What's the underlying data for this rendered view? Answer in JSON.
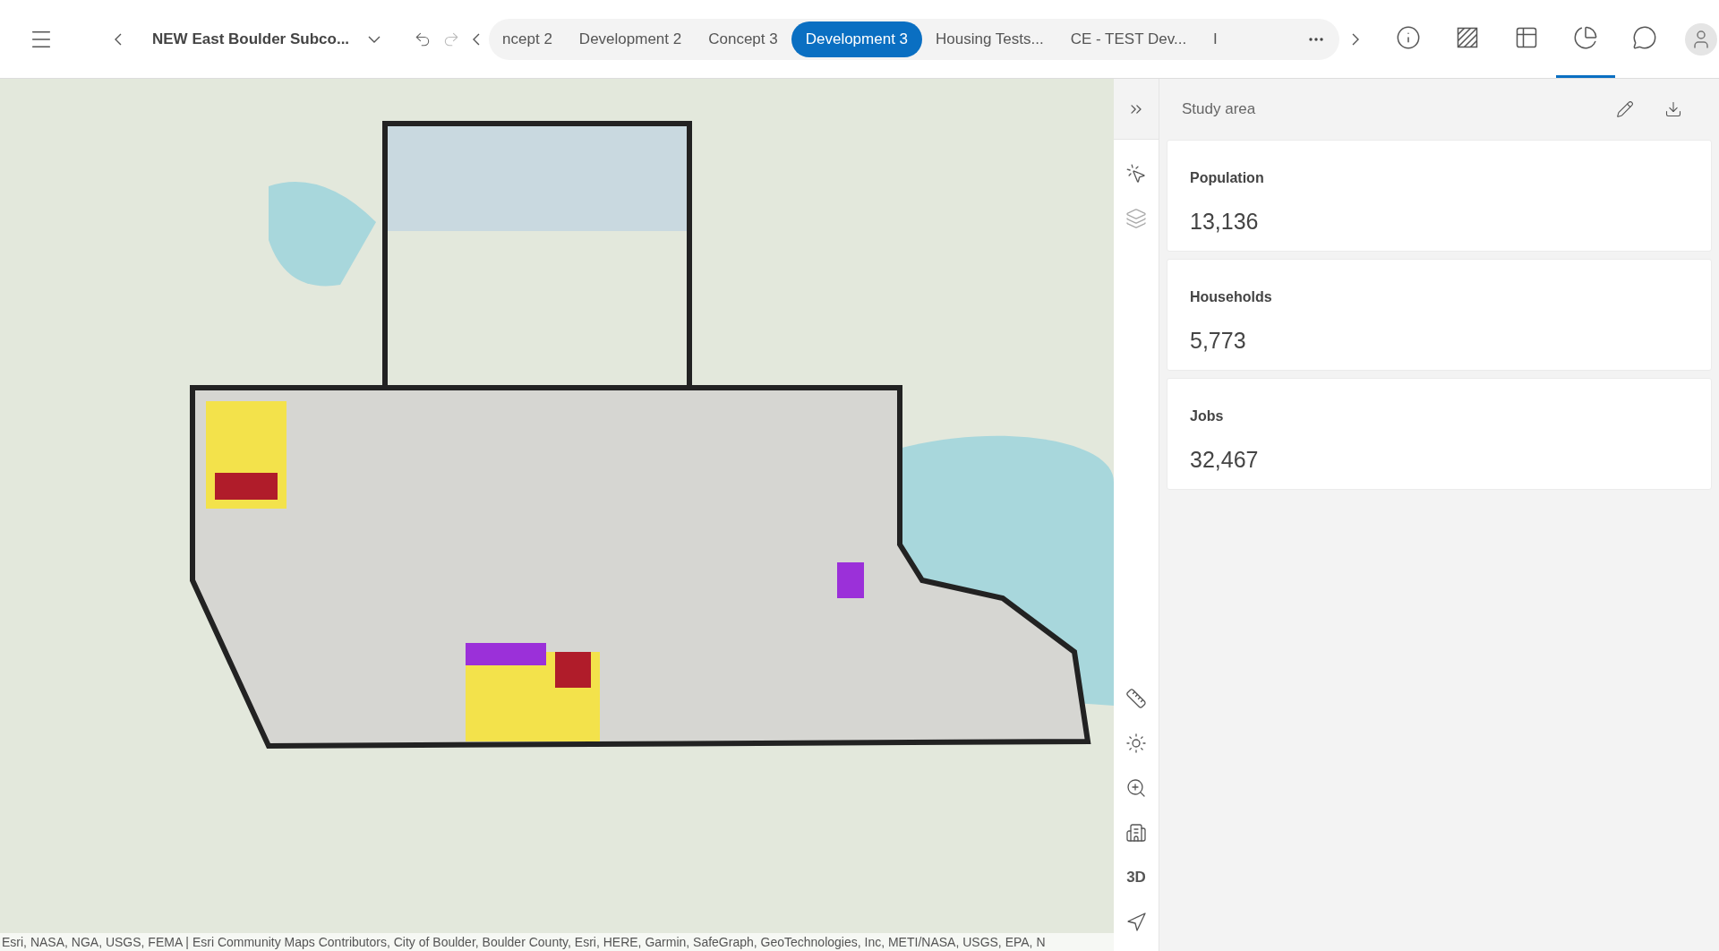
{
  "project": {
    "title": "NEW East Boulder Subco..."
  },
  "scenario_tabs": [
    {
      "label": "ncept 2",
      "selected": false
    },
    {
      "label": "Development 2",
      "selected": false
    },
    {
      "label": "Concept 3",
      "selected": false
    },
    {
      "label": "Development 3",
      "selected": true
    },
    {
      "label": "Housing Tests...",
      "selected": false
    },
    {
      "label": "CE - TEST Dev...",
      "selected": false
    },
    {
      "label": "I",
      "selected": false
    }
  ],
  "toolbar": [
    {
      "kind": "info",
      "selected": false
    },
    {
      "kind": "hatch",
      "selected": false
    },
    {
      "kind": "table",
      "selected": false
    },
    {
      "kind": "chart",
      "selected": true
    },
    {
      "kind": "comment",
      "selected": false
    }
  ],
  "map": {
    "attribution": "Esri, NASA, NGA, USGS, FEMA | Esri Community Maps Contributors, City of Boulder, Boulder County, Esri, HERE, Garmin, SafeGraph, GeoTechnologies, Inc, METI/NASA, USGS, EPA, N"
  },
  "map_tools": {
    "label_3d": "3D"
  },
  "panel": {
    "title": "Study area",
    "metrics": [
      {
        "label": "Population",
        "value": "13,136"
      },
      {
        "label": "Households",
        "value": "5,773"
      },
      {
        "label": "Jobs",
        "value": "32,467"
      }
    ]
  }
}
